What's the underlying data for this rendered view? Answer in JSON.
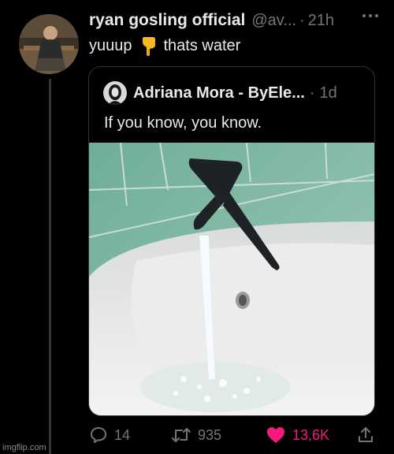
{
  "tweet": {
    "author_name": "ryan gosling official",
    "handle": "@av...",
    "separator": "·",
    "time": "21h",
    "text_before": "yuuup",
    "hand_icon": "backhand-index-pointing-down-icon",
    "text_after": "thats water"
  },
  "quote": {
    "author_name": "Adriana Mora - ByEle...",
    "separator": "·",
    "time": "1d",
    "text": "If you know, you know."
  },
  "actions": {
    "replies": "14",
    "retweets": "935",
    "likes": "13,6K",
    "like_color": "#f91880"
  },
  "watermark": "imgflip.com"
}
